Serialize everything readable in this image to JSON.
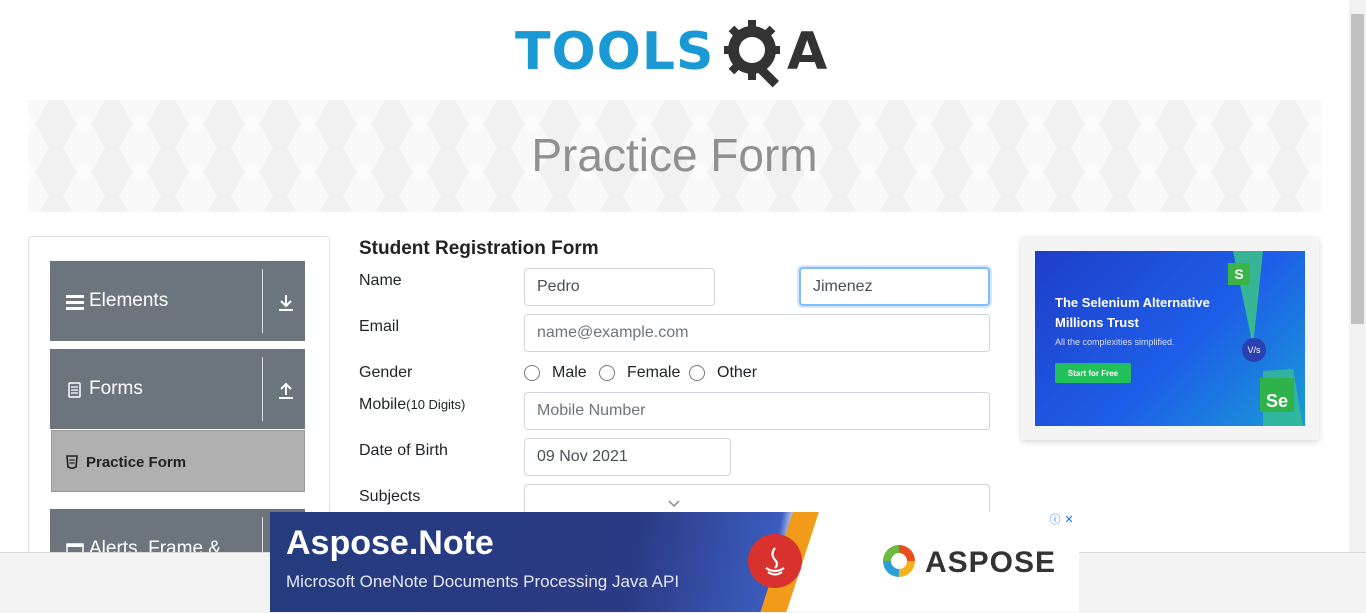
{
  "logo": {
    "text_main": "TOOLS",
    "text_q": "Q",
    "text_a": "A"
  },
  "banner": {
    "title": "Practice Form"
  },
  "sidebar": {
    "groups": [
      {
        "label": "Elements",
        "icon": "list-icon",
        "arrow": "download-arrow-icon"
      },
      {
        "label": "Forms",
        "icon": "document-icon",
        "arrow": "upload-arrow-icon"
      },
      {
        "label": "Alerts, Frame &",
        "icon": "window-icon",
        "arrow": "download-arrow-icon"
      }
    ],
    "active_item": {
      "label": "Practice Form",
      "icon": "form-icon"
    }
  },
  "form": {
    "title": "Student Registration Form",
    "name_label": "Name",
    "first_name_value": "Pedro",
    "last_name_value": "Jimenez",
    "email_label": "Email",
    "email_placeholder": "name@example.com",
    "gender_label": "Gender",
    "gender_options": [
      "Male",
      "Female",
      "Other"
    ],
    "mobile_label": "Mobile",
    "mobile_hint": "(10 Digits)",
    "mobile_placeholder": "Mobile Number",
    "dob_label": "Date of Birth",
    "dob_value": "09 Nov 2021",
    "subjects_label": "Subjects"
  },
  "ad_right": {
    "headline": "The Selenium Alternative Millions Trust",
    "subline": "All the complexities simplified.",
    "cta": "Start for Free",
    "badge_top": "S",
    "badge_bottom": "Se",
    "mid_badge": "V/s"
  },
  "ad_bottom": {
    "title": "Aspose.Note",
    "subtitle": "Microsoft OneNote Documents Processing  Java API",
    "brand": "ASPOSE",
    "info_icon": "ⓘ",
    "close_icon": "✕"
  },
  "colors": {
    "brand_blue": "#1b99d4",
    "sidebar_bg": "#6c757d",
    "active_bg": "#b0b0b0",
    "focus_border": "#80bdff"
  }
}
